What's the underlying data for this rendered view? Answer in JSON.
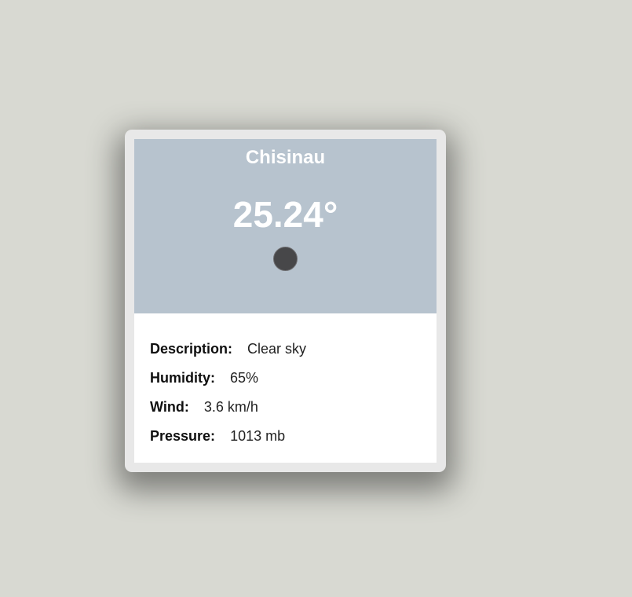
{
  "card": {
    "city": "Chisinau",
    "temperature": "25.24°",
    "icon": "weather-condition-icon",
    "details": [
      {
        "label": "Description:",
        "value": "Clear sky"
      },
      {
        "label": "Humidity:",
        "value": "65%"
      },
      {
        "label": "Wind:",
        "value": "3.6 km/h"
      },
      {
        "label": "Pressure:",
        "value": "1013 mb"
      }
    ]
  },
  "colors": {
    "page_background": "#d8d9d2",
    "card_frame": "#e8e8e8",
    "header_background": "#b7c3ce",
    "icon_fill": "#474749"
  }
}
